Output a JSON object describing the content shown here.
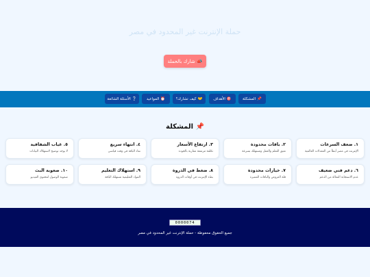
{
  "hero": {
    "title": "حملة الإنترنت غير المحدود في مصر",
    "cta_icon": "📣",
    "cta_label": "شارك بالحملة"
  },
  "nav": {
    "items": [
      {
        "icon": "📌",
        "label": "المشكلة"
      },
      {
        "icon": "🎯",
        "label": "الأهداف"
      },
      {
        "icon": "🤝",
        "label": "كيف تشارك؟"
      },
      {
        "icon": "⏰",
        "label": "المواعيد"
      },
      {
        "icon": "❔",
        "label": "الأسئلة الشائعة"
      }
    ]
  },
  "problem": {
    "icon": "📌",
    "title": "المشكلة",
    "cards": [
      {
        "title": "١. ضعف السرعات",
        "desc": "الإنترنت في مصر أبطأ من المعدلات العالمية"
      },
      {
        "title": "٢. باقات محدودة",
        "desc": "تعيق التعلم والعمل وتستهلك بسرعة"
      },
      {
        "title": "٣. ارتفاع الأسعار",
        "desc": "تكلفة مرتفعة مقارنة بالجودة"
      },
      {
        "title": "٤. انتهاء سريع",
        "desc": "نفاد الباقة في وقت قياسي"
      },
      {
        "title": "٥. غياب الشفافية",
        "desc": "لا يوجد توضيح لاستهلاك البيانات"
      },
      {
        "title": "٦. دعم فني ضعيف",
        "desc": "عدم الاستجابة الفعالة من الدعم"
      },
      {
        "title": "٧. خيارات محدودة",
        "desc": "قلة العروض والباقات المميزة"
      },
      {
        "title": "٨. ضغط في الذروة",
        "desc": "بطء الإنترنت في أوقات الذروة"
      },
      {
        "title": "٩. استهلاك التعليم",
        "desc": "المواد التعليمية تستهلك الباقة"
      },
      {
        "title": "١٠. صعوبة البث",
        "desc": "صعوبة الوصول لمحتوى الفيديو"
      }
    ]
  },
  "footer": {
    "counter": "0000074",
    "copyright": "جميع الحقوق محفوظة - حملة الإنترنت غير المحدود في مصر"
  }
}
